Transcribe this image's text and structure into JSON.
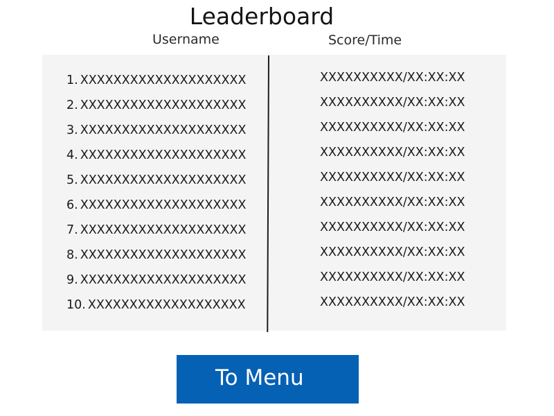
{
  "title": "Leaderboard",
  "columns": {
    "username": "Username",
    "score": "Score/Time"
  },
  "entries": [
    {
      "rank": "1.",
      "username": "XXXXXXXXXXXXXXXXXXXX",
      "score": "XXXXXXXXXX/XX:XX:XX"
    },
    {
      "rank": "2.",
      "username": "XXXXXXXXXXXXXXXXXXXX",
      "score": "XXXXXXXXXX/XX:XX:XX"
    },
    {
      "rank": "3.",
      "username": "XXXXXXXXXXXXXXXXXXXX",
      "score": "XXXXXXXXXX/XX:XX:XX"
    },
    {
      "rank": "4.",
      "username": "XXXXXXXXXXXXXXXXXXXX",
      "score": "XXXXXXXXXX/XX:XX:XX"
    },
    {
      "rank": "5.",
      "username": "XXXXXXXXXXXXXXXXXXXX",
      "score": "XXXXXXXXXX/XX:XX:XX"
    },
    {
      "rank": "6.",
      "username": "XXXXXXXXXXXXXXXXXXXX",
      "score": "XXXXXXXXXX/XX:XX:XX"
    },
    {
      "rank": "7.",
      "username": "XXXXXXXXXXXXXXXXXXXX",
      "score": "XXXXXXXXXX/XX:XX:XX"
    },
    {
      "rank": "8.",
      "username": "XXXXXXXXXXXXXXXXXXXX",
      "score": "XXXXXXXXXX/XX:XX:XX"
    },
    {
      "rank": "9.",
      "username": "XXXXXXXXXXXXXXXXXXXX",
      "score": "XXXXXXXXXX/XX:XX:XX"
    },
    {
      "rank": "10.",
      "username": "XXXXXXXXXXXXXXXXXXX",
      "score": "XXXXXXXXXX/XX:XX:XX"
    }
  ],
  "menu_button": {
    "label": "To Menu"
  },
  "colors": {
    "button_background": "#0561b4",
    "button_text": "#ffffff",
    "panel_background": "#f4f4f4",
    "divider": "#1c1c1c"
  }
}
